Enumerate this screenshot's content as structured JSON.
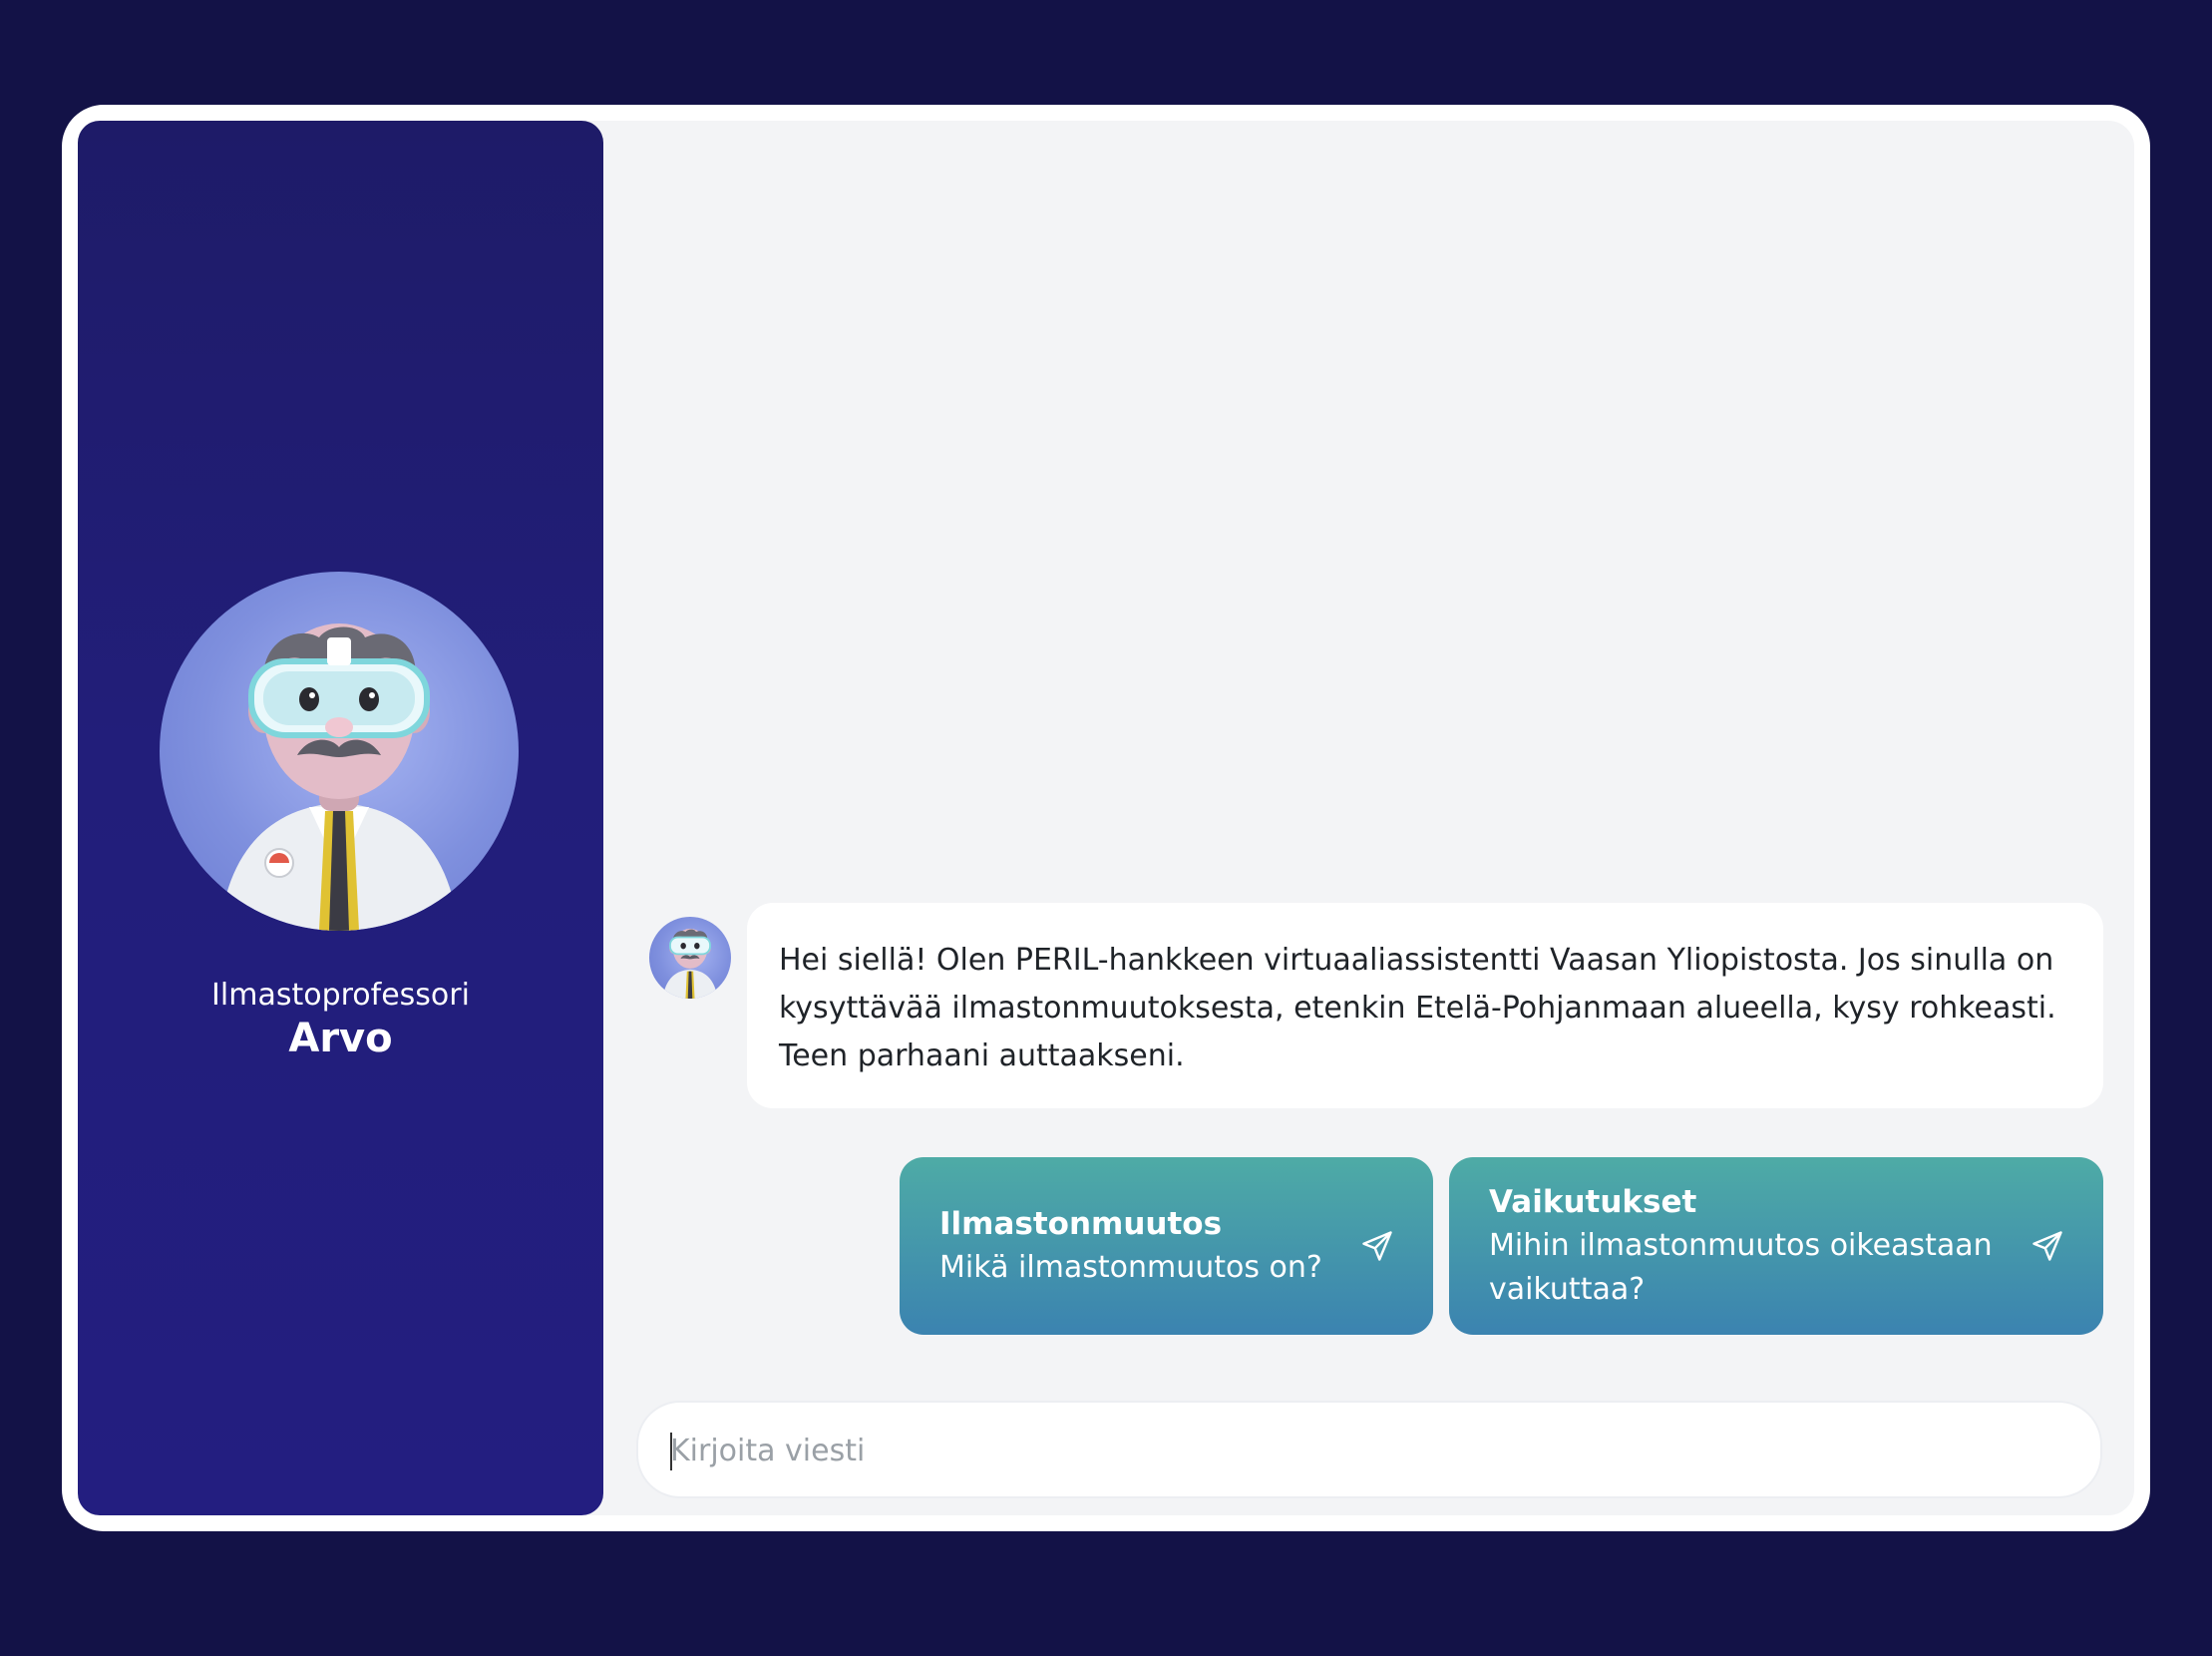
{
  "assistant": {
    "role": "Ilmastoprofessori",
    "name": "Arvo"
  },
  "messages": [
    {
      "from": "assistant",
      "text": "Hei siellä! Olen PERIL-hankkeen virtuaaliassistentti Vaasan Yliopistosta. Jos sinulla on kysyttävää ilmastonmuutoksesta, etenkin Etelä-Pohjanmaan alueella, kysy rohkeasti. Teen parhaani auttaakseni."
    }
  ],
  "suggestions": [
    {
      "title": "Ilmastonmuutos",
      "text": "Mikä ilmastonmuutos on?",
      "icon": "send-icon"
    },
    {
      "title": "Vaikutukset",
      "text": "Mihin ilmastonmuutos oikeastaan vaikuttaa?",
      "icon": "send-icon"
    }
  ],
  "input": {
    "placeholder": "Kirjoita viesti",
    "value": ""
  },
  "colors": {
    "background": "#131247",
    "sidebar": "#221e7a",
    "panel": "#f3f4f6",
    "suggestion_top": "#4eaba6",
    "suggestion_bottom": "#3b83b0"
  }
}
